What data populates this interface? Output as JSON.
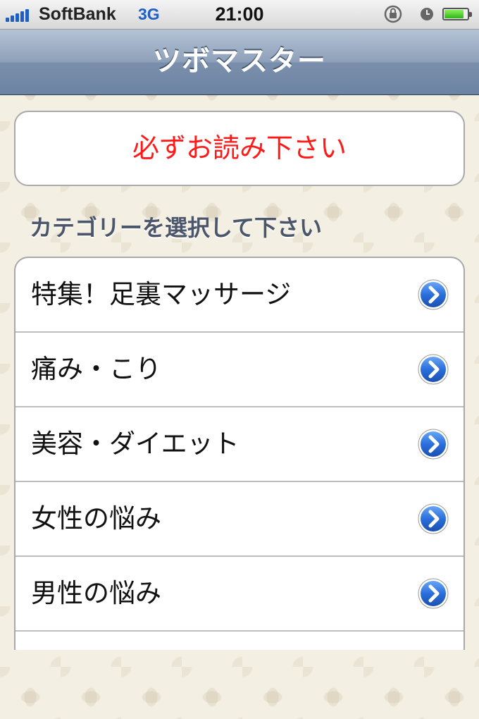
{
  "status_bar": {
    "carrier": "SoftBank",
    "network": "3G",
    "time": "21:00",
    "signal_bars": 5,
    "battery_level": 0.85,
    "icons": [
      "signal-icon",
      "rotation-lock-icon",
      "alarm-icon",
      "battery-icon"
    ],
    "network_color": "#1f5fc4"
  },
  "nav": {
    "title": "ツボマスター"
  },
  "notice": {
    "label": "必ずお読み下さい",
    "color": "#ff1a1a"
  },
  "categories": {
    "header": "カテゴリーを選択して下さい",
    "items": [
      {
        "label": "特集！足裏マッサージ",
        "icon": "disclosure-arrow-icon"
      },
      {
        "label": "痛み・こり",
        "icon": "disclosure-arrow-icon"
      },
      {
        "label": "美容・ダイエット",
        "icon": "disclosure-arrow-icon"
      },
      {
        "label": "女性の悩み",
        "icon": "disclosure-arrow-icon"
      },
      {
        "label": "男性の悩み",
        "icon": "disclosure-arrow-icon"
      },
      {
        "label": "",
        "icon": ""
      }
    ]
  },
  "colors": {
    "nav_bar": "#7a8fab",
    "background": "#f3efe3",
    "disclosure_blue": "#2a6fdc"
  }
}
